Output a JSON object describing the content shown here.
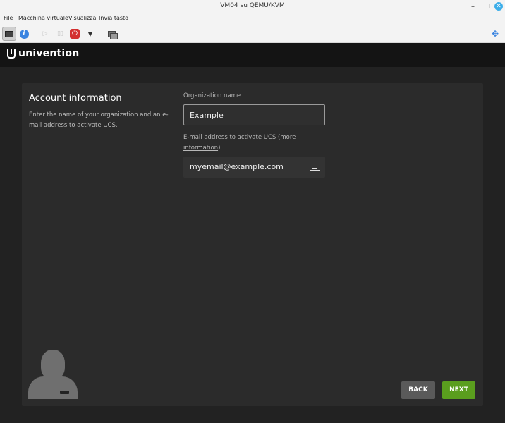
{
  "window": {
    "title": "VM04 su QEMU/KVM",
    "min_glyph": "–",
    "max_glyph": "□",
    "close_glyph": "✕"
  },
  "menubar": {
    "items": [
      {
        "label": "File"
      },
      {
        "label": "Macchina virtuale"
      },
      {
        "label": "Visualizza"
      },
      {
        "label": "Invia tasto"
      }
    ]
  },
  "toolbar": {
    "icons": [
      "console-icon",
      "info-icon",
      "play-icon",
      "pause-icon",
      "power-icon",
      "dropdown-icon",
      "snapshot-icon",
      "resize-icon"
    ],
    "info_glyph": "i",
    "play_glyph": "▷",
    "pause_glyph": "▯▯",
    "power_glyph": "⏻",
    "dropdown_glyph": "▼",
    "resize_glyph": "✥"
  },
  "guest": {
    "brand": "univention",
    "section_title": "Account information",
    "section_desc": "Enter the name of your organization and an e-mail address to activate UCS.",
    "org_label": "Organization name",
    "org_value": "Example",
    "email_label_prefix": "E-mail address to activate UCS (",
    "email_label_link": "more information",
    "email_label_suffix": ")",
    "email_value": "myemail@example.com",
    "back_label": "BACK",
    "next_label": "NEXT"
  },
  "colors": {
    "next_button": "#5a9e1e",
    "back_button": "#5a5a5a",
    "panel": "#2b2b2b",
    "background": "#222222"
  }
}
